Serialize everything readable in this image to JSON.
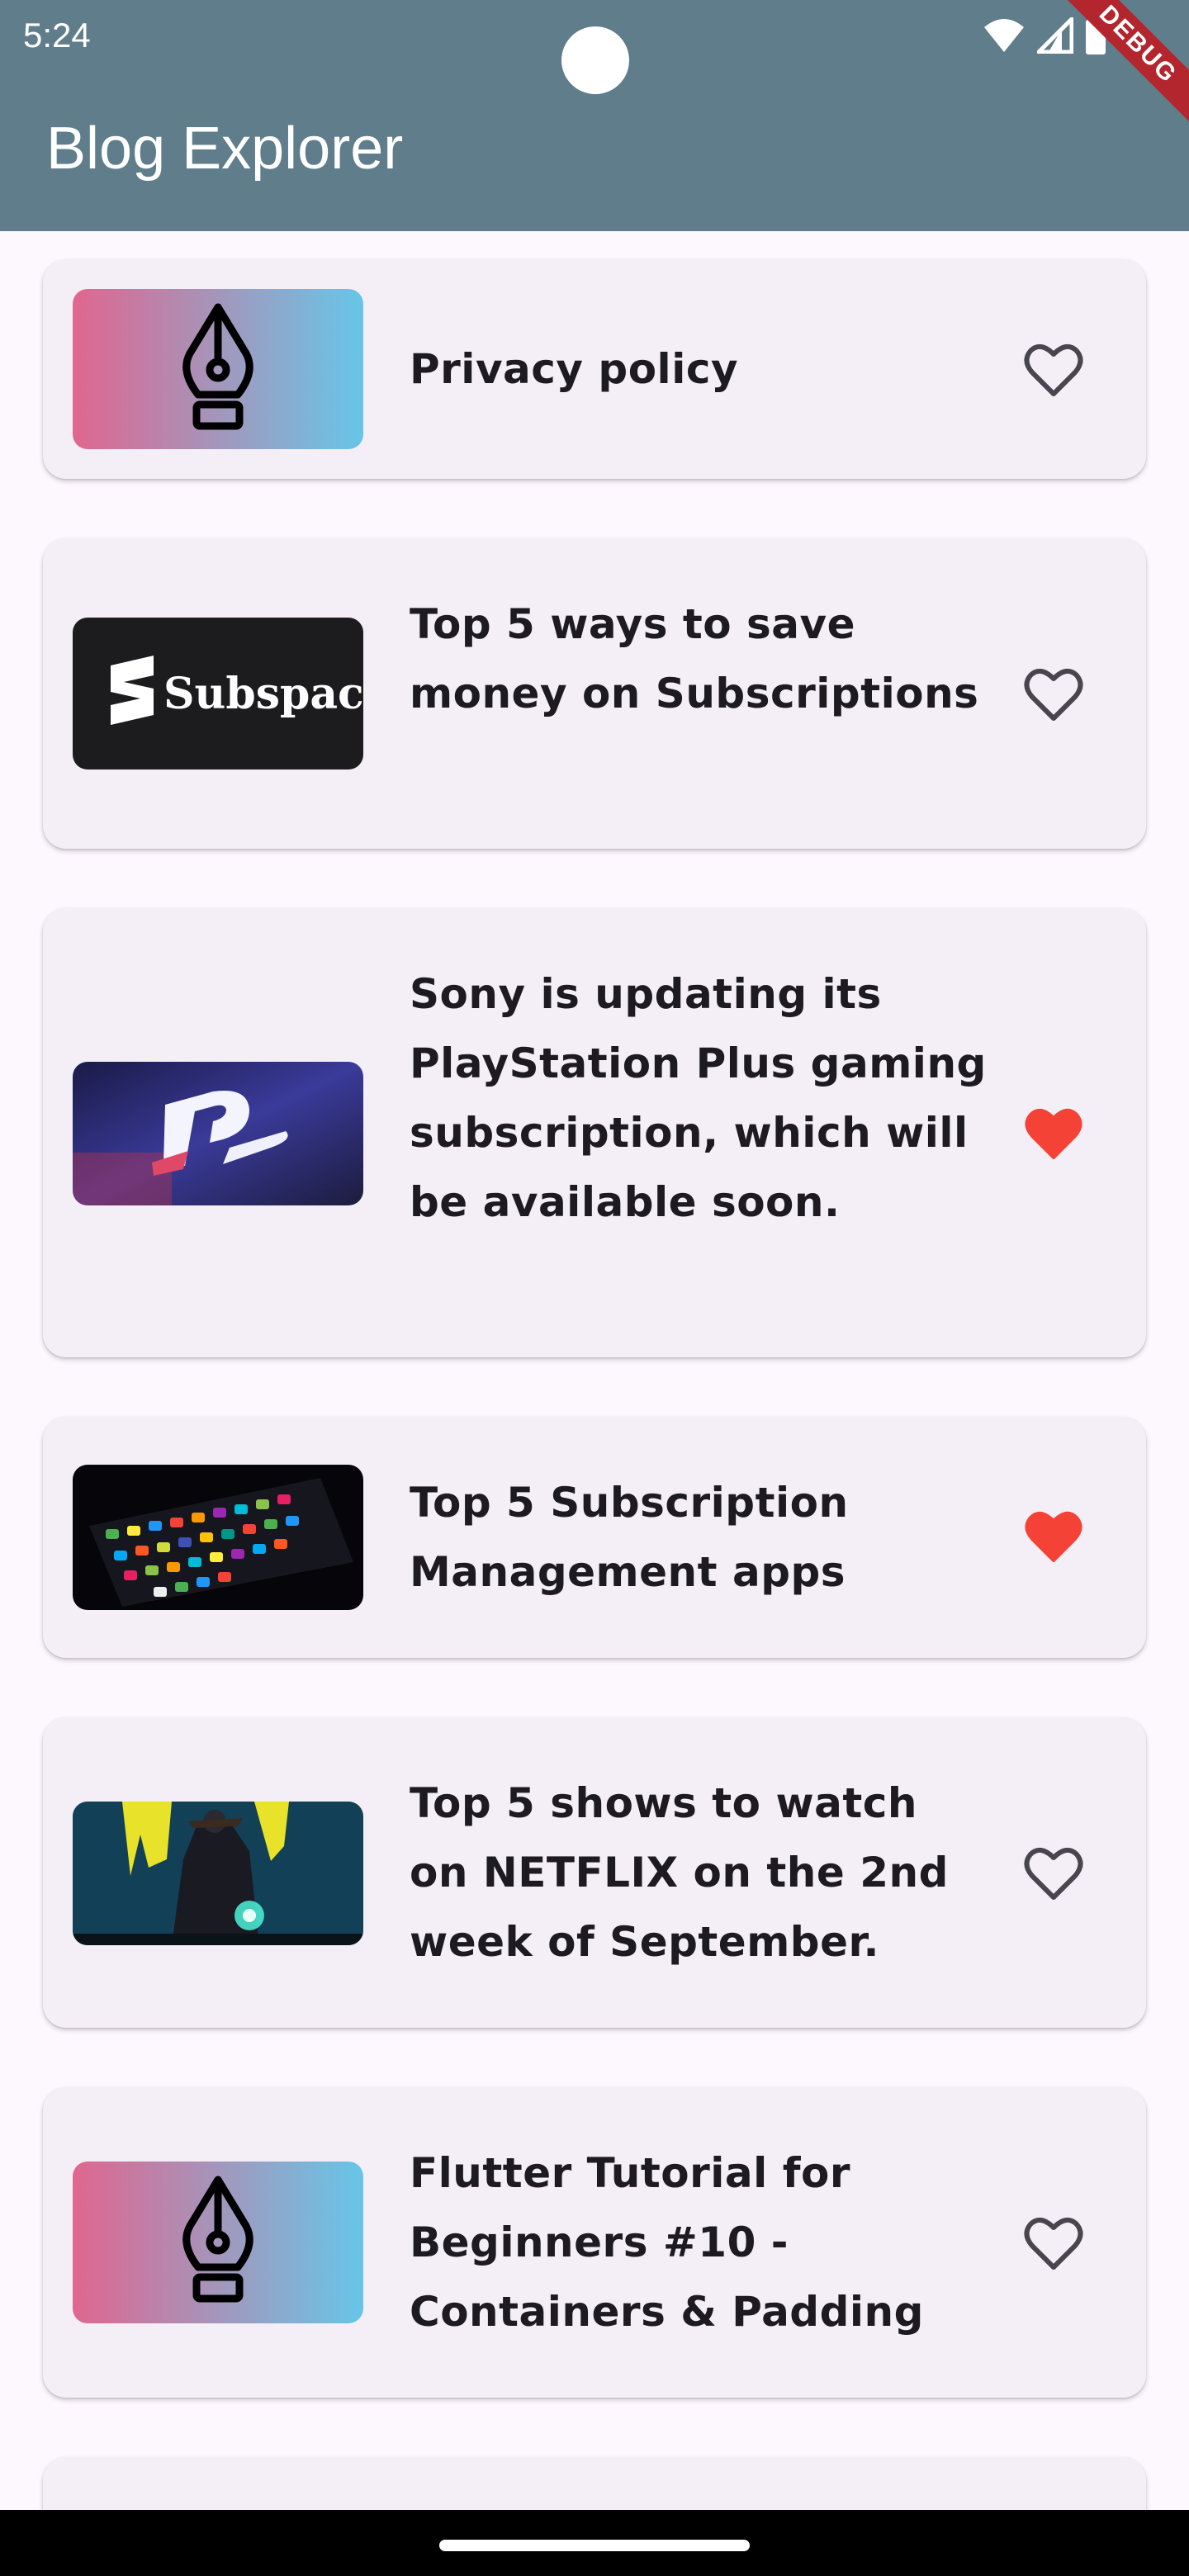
{
  "status_bar": {
    "time": "5:24"
  },
  "debug_banner": "DEBUG",
  "app_bar": {
    "title": "Blog Explorer"
  },
  "colors": {
    "app_bar": "#607d8b",
    "background": "#fdf7fe",
    "card": "#f4eff6",
    "favorite_active": "#f44336",
    "favorite_inactive": "#49454f"
  },
  "posts": [
    {
      "title": "Privacy policy",
      "thumbnail": "pen-nib-gradient-image",
      "favorite": false
    },
    {
      "title": "Top 5 ways to save money on Subscriptions",
      "thumbnail": "subspace-logo-image",
      "thumbnail_text": "Subspace.",
      "favorite": false
    },
    {
      "title": "Sony is updating its PlayStation Plus gaming subscription, which will be available soon.",
      "thumbnail": "playstation-logo-image",
      "favorite": true
    },
    {
      "title": "Top 5 Subscription Management apps",
      "thumbnail": "phone-apps-image",
      "favorite": true
    },
    {
      "title": "Top 5 shows to watch on NETFLIX on the 2nd week of September.",
      "thumbnail": "netflix-show-image",
      "favorite": false
    },
    {
      "title": "Flutter Tutorial for Beginners #10 - Containers & Padding",
      "thumbnail": "pen-nib-gradient-image",
      "favorite": false
    }
  ]
}
